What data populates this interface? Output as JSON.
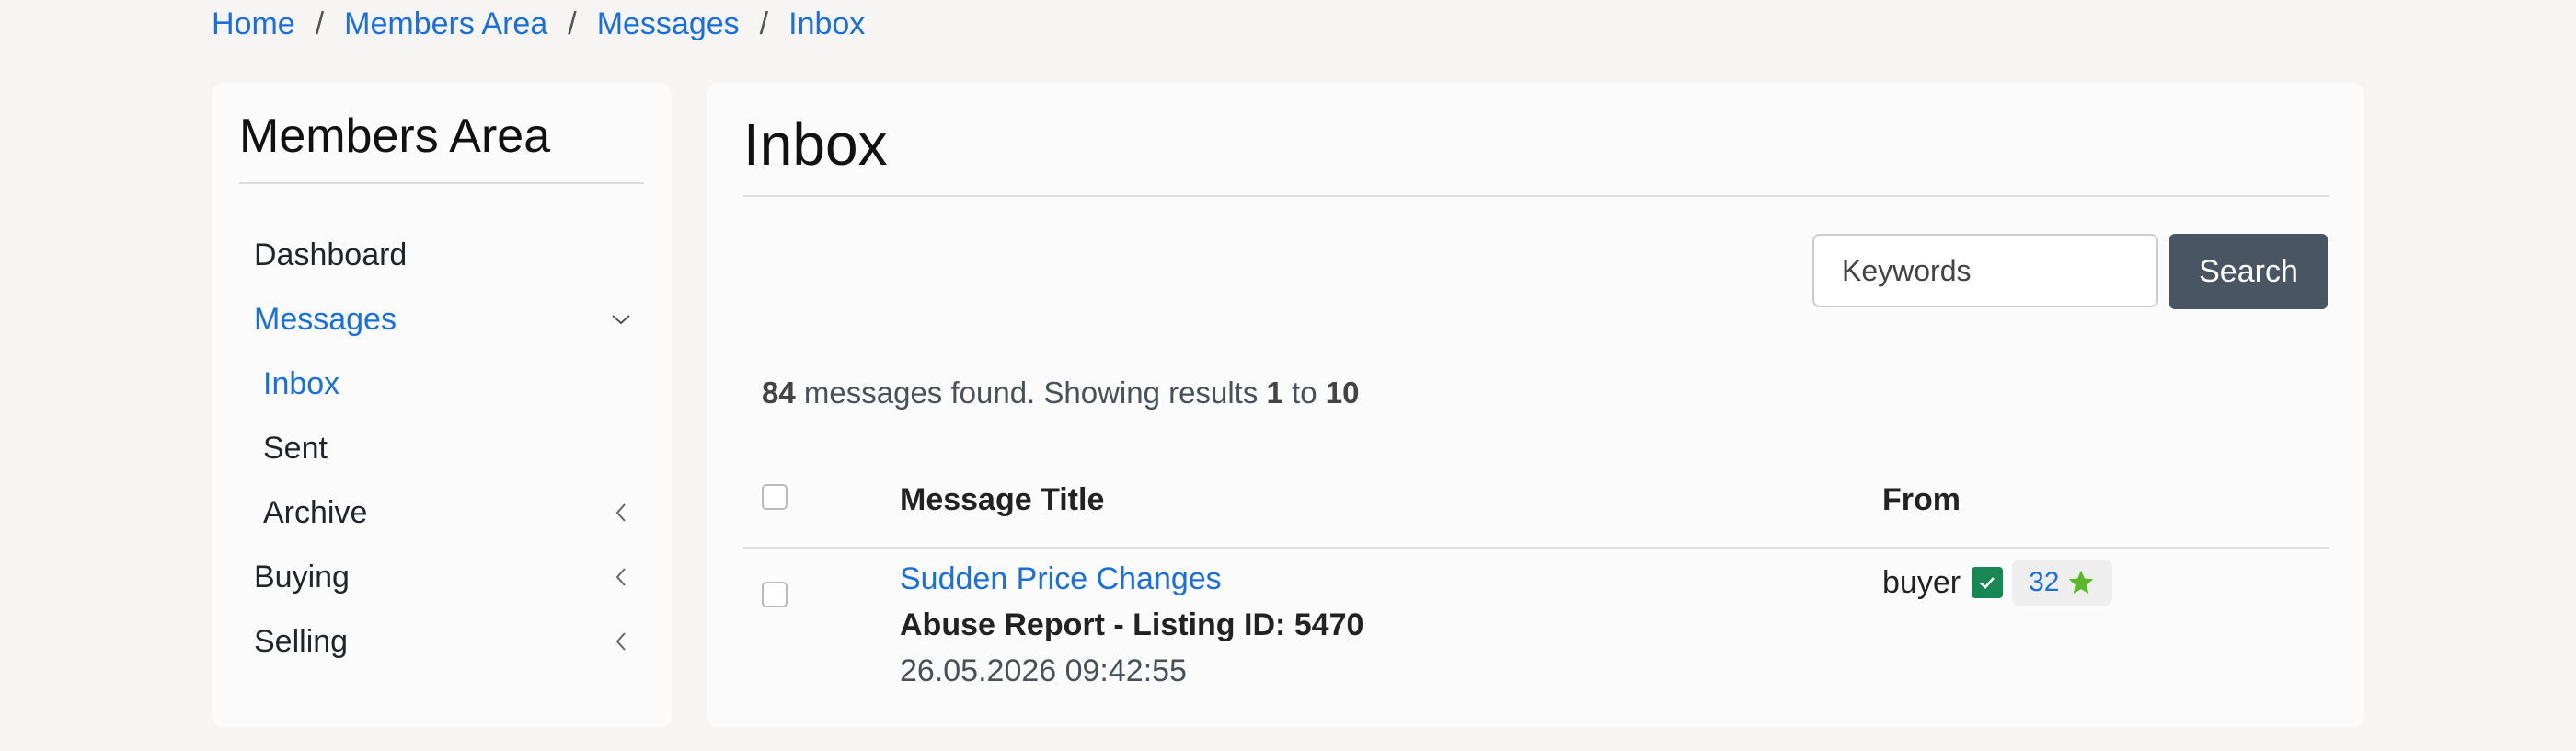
{
  "breadcrumb": {
    "items": [
      "Home",
      "Members Area",
      "Messages",
      "Inbox"
    ],
    "separator": "/"
  },
  "sidebar": {
    "title": "Members Area",
    "items": [
      {
        "label": "Dashboard",
        "icon": "",
        "active": false
      },
      {
        "label": "Messages",
        "icon": "chevron-down-icon",
        "active": true
      },
      {
        "label": "Inbox",
        "icon": "",
        "active": true,
        "sub": true
      },
      {
        "label": "Sent",
        "icon": "",
        "active": false,
        "sub": true
      },
      {
        "label": "Archive",
        "icon": "chevron-left-icon",
        "active": false,
        "sub": true
      },
      {
        "label": "Buying",
        "icon": "chevron-left-icon",
        "active": false
      },
      {
        "label": "Selling",
        "icon": "chevron-left-icon",
        "active": false
      }
    ]
  },
  "main": {
    "title": "Inbox",
    "search": {
      "placeholder": "Keywords",
      "button_label": "Search"
    },
    "results": {
      "total": "84",
      "text1": "messages found. Showing results",
      "from": "1",
      "text2": "to",
      "to": "10"
    },
    "table": {
      "columns": [
        "Message Title",
        "From"
      ],
      "rows": [
        {
          "title": "Sudden Price Changes",
          "subject": "Abuse Report - Listing ID: 5470",
          "date": "26.05.2026 09:42:55",
          "from": "buyer",
          "rating": "32"
        }
      ]
    }
  },
  "colors": {
    "accent": "#1a6fdc",
    "button_bg": "#4a5563",
    "verified": "#198754",
    "star": "#5cb82a",
    "page_bg": "#f6f5f3"
  }
}
